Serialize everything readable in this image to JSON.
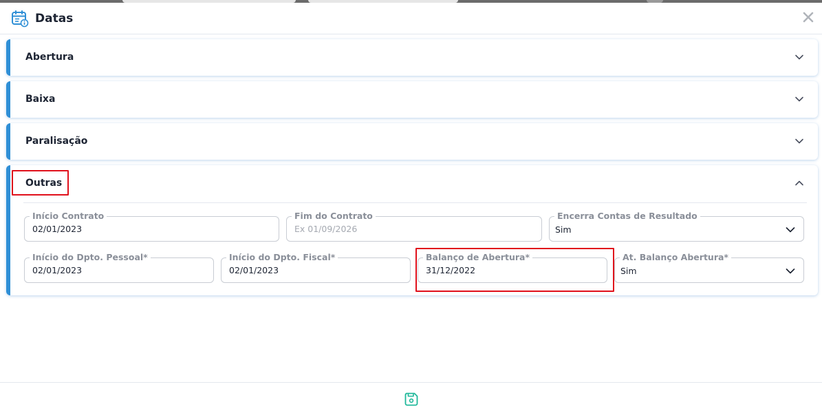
{
  "modal": {
    "title": "Datas",
    "icons": {
      "title": "calendar-info-icon",
      "close": "close-icon",
      "save": "save-icon"
    }
  },
  "sections": [
    {
      "title": "Abertura",
      "expanded": false
    },
    {
      "title": "Baixa",
      "expanded": false
    },
    {
      "title": "Paralisação",
      "expanded": false
    },
    {
      "title": "Outras",
      "expanded": true
    }
  ],
  "outras": {
    "inicio_contrato": {
      "label": "Início Contrato",
      "value": "02/01/2023"
    },
    "fim_contrato": {
      "label": "Fim do Contrato",
      "placeholder": "Ex 01/09/2026"
    },
    "encerra_contas": {
      "label": "Encerra Contas de Resultado",
      "value": "Sim"
    },
    "inicio_dpto_pessoal": {
      "label": "Início do Dpto. Pessoal*",
      "value": "02/01/2023"
    },
    "inicio_dpto_fiscal": {
      "label": "Início do Dpto. Fiscal*",
      "value": "02/01/2023"
    },
    "balanco_abertura": {
      "label": "Balanço de Abertura*",
      "value": "31/12/2022"
    },
    "at_balanco_abertura": {
      "label": "At. Balanço Abertura*",
      "value": "Sim"
    }
  },
  "colors": {
    "accent": "#2f8fd6",
    "highlight": "#e0101b",
    "save": "#1fb89a",
    "title_icon": "#2f8fd6"
  }
}
